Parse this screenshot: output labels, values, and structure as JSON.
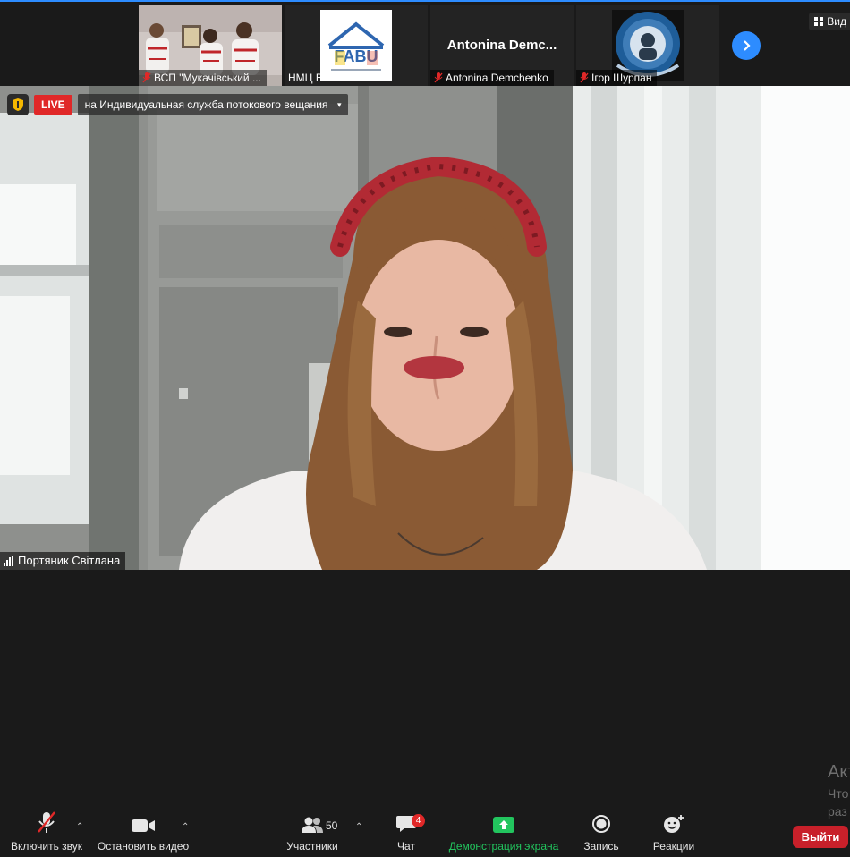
{
  "participants_strip": [
    {
      "name": "ВСП \"Мукачівський ...",
      "muted": true,
      "has_video": true
    },
    {
      "name": "НМЦ ВФПО",
      "muted": false,
      "has_logo": true,
      "logo_text": "FABU"
    },
    {
      "name": "Antonina Demchenko",
      "display_name": "Antonina Demc...",
      "muted": true
    },
    {
      "name": "Ігор Шурпан",
      "muted": true,
      "has_logo": true
    }
  ],
  "view_button": {
    "label": "Вид",
    "icon": "grid-icon"
  },
  "next_page_button": {
    "icon": "chevron-right-icon"
  },
  "live": {
    "badge": "LIVE",
    "stream_label": "на Индивидуальная служба потокового вещания",
    "caret": "▾"
  },
  "active_speaker": {
    "name": "Портяник Світлана"
  },
  "toolbar": {
    "mute": {
      "label": "Включить звук",
      "icon": "microphone-muted-icon"
    },
    "video": {
      "label": "Остановить видео",
      "icon": "video-camera-icon"
    },
    "participants": {
      "label": "Участники",
      "count": "50",
      "icon": "participants-icon"
    },
    "chat": {
      "label": "Чат",
      "badge": "4",
      "icon": "chat-icon"
    },
    "share": {
      "label": "Демонстрация экрана",
      "icon": "share-screen-icon"
    },
    "record": {
      "label": "Запись",
      "icon": "record-icon"
    },
    "reactions": {
      "label": "Реакции",
      "icon": "reaction-icon"
    },
    "leave": {
      "label": "Выйти"
    },
    "caret": "⌃"
  },
  "watermark": {
    "line1": "Акт",
    "line2": "Что",
    "line3": "раз"
  },
  "colors": {
    "accent": "#2d8cff",
    "live": "#e02828",
    "share": "#22c55e",
    "leave": "#c8202a"
  }
}
